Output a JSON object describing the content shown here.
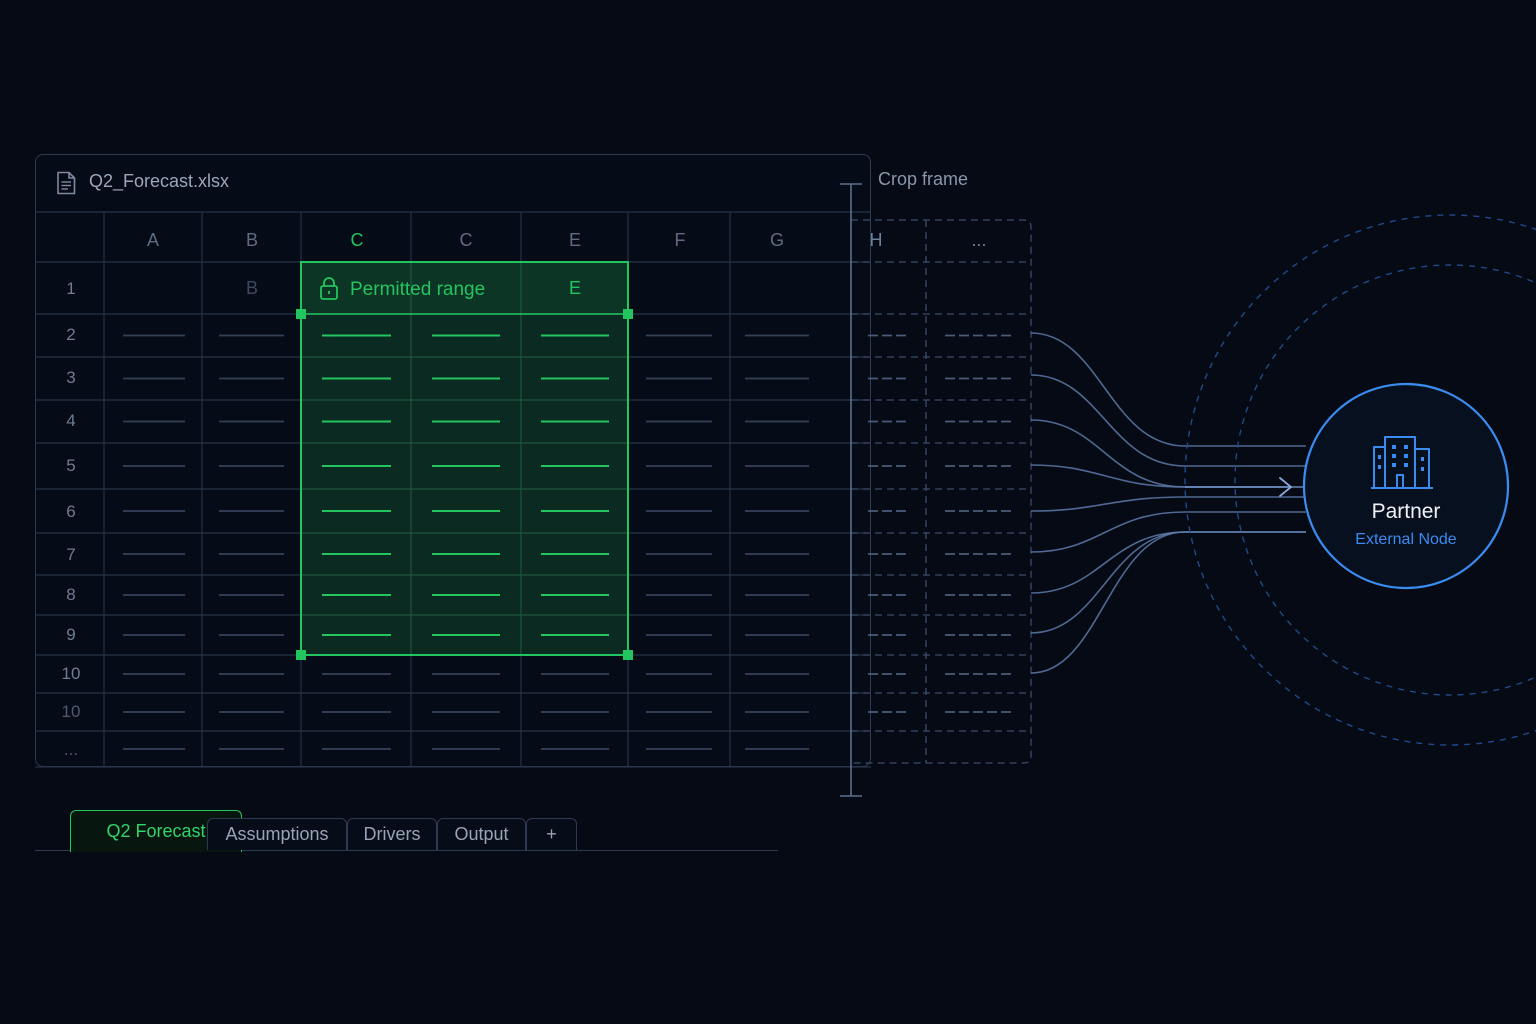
{
  "window": {
    "file_name": "Q2_Forecast.xlsx",
    "file_icon": "document-icon"
  },
  "crop_frame": {
    "label": "Crop frame"
  },
  "grid": {
    "columns": [
      "A",
      "B",
      "C",
      "C",
      "E",
      "F",
      "G",
      "H",
      "..."
    ],
    "row_numbers": [
      "1",
      "2",
      "3",
      "4",
      "5",
      "6",
      "7",
      "8",
      "9",
      "10",
      "10",
      "..."
    ],
    "row1_cells": [
      "B",
      "E"
    ]
  },
  "selection": {
    "label": "Permitted range",
    "icon": "lock-icon",
    "color": "#22c55e"
  },
  "tabs": [
    {
      "label": "Q2 Forecast",
      "active": true
    },
    {
      "label": "Assumptions",
      "active": false
    },
    {
      "label": "Drivers",
      "active": false
    },
    {
      "label": "Output",
      "active": false
    },
    {
      "label": "+",
      "active": false
    }
  ],
  "partner": {
    "title": "Partner",
    "subtitle": "External Node",
    "icon": "building-icon",
    "color": "#3b8cf0"
  }
}
